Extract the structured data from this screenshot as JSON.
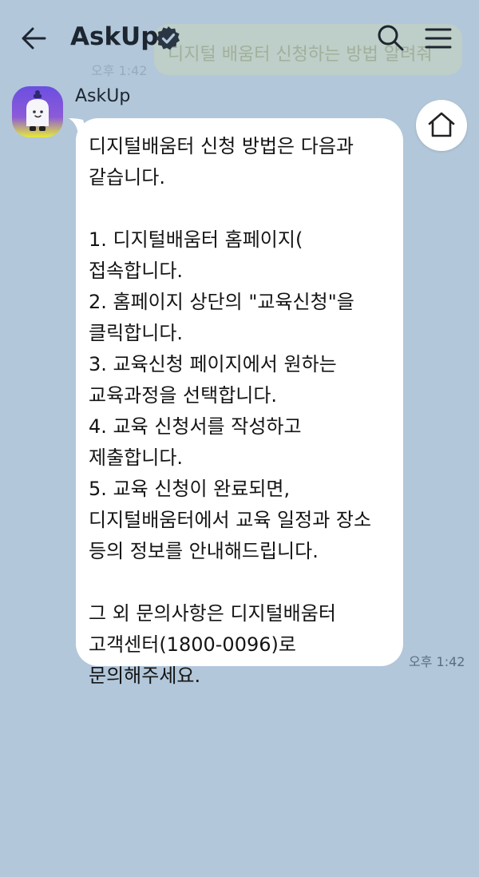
{
  "header": {
    "title": "AskUp",
    "back_icon": "arrow-left-icon",
    "verified_icon": "verified-badge-icon",
    "search_icon": "search-icon",
    "menu_icon": "hamburger-menu-icon"
  },
  "previous_message": {
    "text": "디지털 배움터 신청하는 방법 알려줘",
    "time": "오후 1:42"
  },
  "bot": {
    "name": "AskUp",
    "avatar_icon": "askup-bot-avatar"
  },
  "home_button": {
    "icon": "home-icon"
  },
  "message": {
    "intro": "디지털배움터 신청 방법은 다음과 같습니다.",
    "steps": [
      "1. 디지털배움터 홈페이지( 접속합니다.",
      "2. 홈페이지 상단의 \"교육신청\"을 클릭합니다.",
      "3. 교육신청 페이지에서 원하는 교육과정을 선택합니다.",
      "4. 교육 신청서를 작성하고 제출합니다.",
      "5. 교육 신청이 완료되면, 디지털배움터에서 교육 일정과 장소 등의 정보를 안내해드립니다."
    ],
    "outro": "그 외 문의사항은 디지털배움터 고객센터(1800-0096)로 문의해주세요.",
    "time": "오후 1:42"
  },
  "colors": {
    "background": "#b2c7da",
    "bubble": "#ffffff",
    "title": "#1d2630"
  }
}
